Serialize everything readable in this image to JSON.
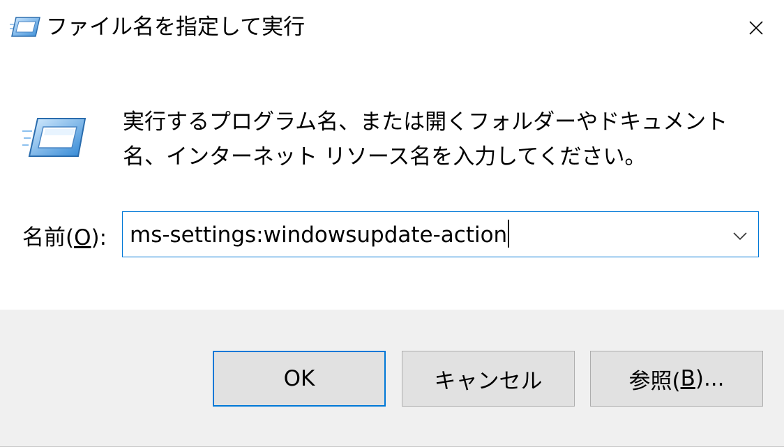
{
  "window": {
    "title": "ファイル名を指定して実行",
    "close_label": "×"
  },
  "content": {
    "description": "実行するプログラム名、または開くフォルダーやドキュメント名、インターネット リソース名を入力してください。",
    "name_label": {
      "before": "名前(",
      "access_key": "O",
      "after": "):"
    },
    "combo": {
      "value": "ms-settings:windowsupdate-action"
    }
  },
  "buttons": {
    "ok_label": "OK",
    "cancel_label": "キャンセル",
    "browse": {
      "before": "参照(",
      "access_key": "B",
      "after": ")..."
    }
  },
  "colors": {
    "accent": "#0078d7",
    "footer_bg": "#f0f0f0",
    "button_bg": "#e1e1e1"
  },
  "icons": {
    "title_icon": "run-icon",
    "content_icon": "run-icon",
    "close_icon": "close-icon",
    "dropdown_icon": "chevron-down-icon"
  }
}
